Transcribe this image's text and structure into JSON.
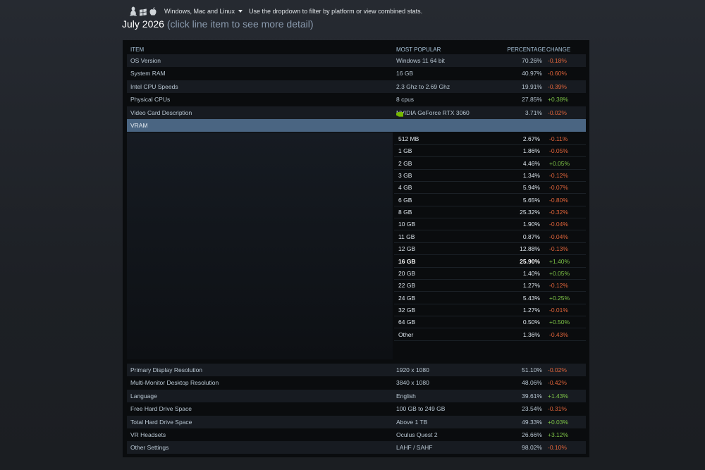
{
  "filter": {
    "platform_label": "Windows, Mac and Linux",
    "hint": "Use the dropdown to filter by platform or view combined stats.",
    "icons": [
      "linux-icon",
      "windows-icon",
      "apple-icon"
    ]
  },
  "heading": {
    "month": "July 2026",
    "hint": "(click line item to see more detail)"
  },
  "columns": {
    "item": "ITEM",
    "popular": "MOST POPULAR",
    "percentage": "PERCENTAGE",
    "change": "CHANGE"
  },
  "top_rows": [
    {
      "item": "OS Version",
      "popular": "Windows 11 64 bit",
      "percentage": "70.26%",
      "change": "-0.18%"
    },
    {
      "item": "System RAM",
      "popular": "16 GB",
      "percentage": "40.97%",
      "change": "-0.60%"
    },
    {
      "item": "Intel CPU Speeds",
      "popular": "2.3 Ghz to 2.69 Ghz",
      "percentage": "19.91%",
      "change": "-0.39%"
    },
    {
      "item": "Physical CPUs",
      "popular": "8 cpus",
      "percentage": "27.85%",
      "change": "+0.38%"
    },
    {
      "item": "Video Card Description",
      "popular": "NVIDIA GeForce RTX 3060",
      "percentage": "3.71%",
      "change": "-0.02%"
    }
  ],
  "vram": {
    "label": "VRAM",
    "rows": [
      {
        "label": "512 MB",
        "percentage": "2.67%",
        "change": "-0.11%"
      },
      {
        "label": "1 GB",
        "percentage": "1.86%",
        "change": "-0.05%"
      },
      {
        "label": "2 GB",
        "percentage": "4.46%",
        "change": "+0.05%"
      },
      {
        "label": "3 GB",
        "percentage": "1.34%",
        "change": "-0.12%"
      },
      {
        "label": "4 GB",
        "percentage": "5.94%",
        "change": "-0.07%"
      },
      {
        "label": "6 GB",
        "percentage": "5.65%",
        "change": "-0.80%"
      },
      {
        "label": "8 GB",
        "percentage": "25.32%",
        "change": "-0.32%"
      },
      {
        "label": "10 GB",
        "percentage": "1.90%",
        "change": "-0.04%"
      },
      {
        "label": "11 GB",
        "percentage": "0.87%",
        "change": "-0.04%"
      },
      {
        "label": "12 GB",
        "percentage": "12.88%",
        "change": "-0.13%"
      },
      {
        "label": "16 GB",
        "percentage": "25.90%",
        "change": "+1.40%",
        "bold": true
      },
      {
        "label": "20 GB",
        "percentage": "1.40%",
        "change": "+0.05%"
      },
      {
        "label": "22 GB",
        "percentage": "1.27%",
        "change": "-0.12%"
      },
      {
        "label": "24 GB",
        "percentage": "5.43%",
        "change": "+0.25%"
      },
      {
        "label": "32 GB",
        "percentage": "1.27%",
        "change": "-0.01%"
      },
      {
        "label": "64 GB",
        "percentage": "0.50%",
        "change": "+0.50%"
      },
      {
        "label": "Other",
        "percentage": "1.36%",
        "change": "-0.43%"
      }
    ]
  },
  "bottom_rows": [
    {
      "item": "Primary Display Resolution",
      "popular": "1920 x 1080",
      "percentage": "51.10%",
      "change": "-0.02%"
    },
    {
      "item": "Multi-Monitor Desktop Resolution",
      "popular": "3840 x 1080",
      "percentage": "48.06%",
      "change": "-0.42%"
    },
    {
      "item": "Language",
      "popular": "English",
      "percentage": "39.61%",
      "change": "+1.43%"
    },
    {
      "item": "Free Hard Drive Space",
      "popular": "100 GB to 249 GB",
      "percentage": "23.54%",
      "change": "-0.31%"
    },
    {
      "item": "Total Hard Drive Space",
      "popular": "Above 1 TB",
      "percentage": "49.33%",
      "change": "+0.03%"
    },
    {
      "item": "VR Headsets",
      "popular": "Oculus Quest 2",
      "percentage": "26.66%",
      "change": "+3.12%"
    },
    {
      "item": "Other Settings",
      "popular": "LAHF / SAHF",
      "percentage": "98.02%",
      "change": "-0.10%"
    }
  ],
  "colors": {
    "negative": "#e0643a",
    "positive": "#7ec447",
    "selected_row": "#4a6582",
    "gpu_brand": "#76b900"
  }
}
